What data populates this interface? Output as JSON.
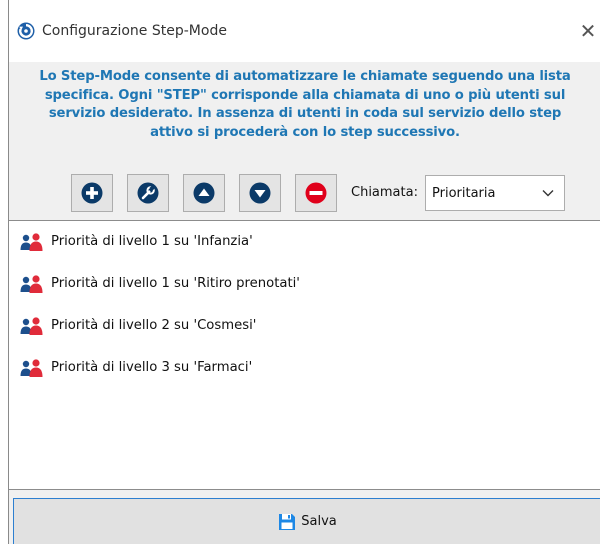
{
  "window": {
    "title": "Configurazione Step-Mode",
    "close_glyph": "✕"
  },
  "description": {
    "lines": [
      "Lo Step-Mode consente di automatizzare le chiamate seguendo una lista",
      "specifica. Ogni \"STEP\" corrisponde alla chiamata di uno o più utenti sul",
      "servizio desiderato. In assenza di utenti in coda sul servizio dello step",
      "attivo si procederà con lo step successivo."
    ],
    "color": "#1f77b4"
  },
  "toolbar": {
    "buttons": [
      {
        "name": "add",
        "icon": "plus-circle-icon",
        "color": "#0b3a68"
      },
      {
        "name": "edit",
        "icon": "wrench-icon",
        "color": "#0b3a68"
      },
      {
        "name": "move-up",
        "icon": "triangle-up-icon",
        "color": "#0b3a68"
      },
      {
        "name": "move-down",
        "icon": "triangle-down-icon",
        "color": "#0b3a68"
      },
      {
        "name": "remove",
        "icon": "minus-circle-icon",
        "color": "#e0001b"
      }
    ],
    "chiamata_label": "Chiamata:",
    "chiamata_value": "Prioritaria"
  },
  "steps": [
    {
      "label": "Priorità di livello 1 su 'Infanzia'",
      "icon": "users-icon"
    },
    {
      "label": "Priorità di livello 1 su 'Ritiro prenotati'",
      "icon": "users-icon"
    },
    {
      "label": "Priorità di livello 2 su 'Cosmesi'",
      "icon": "users-icon"
    },
    {
      "label": "Priorità di livello 3 su 'Farmaci'",
      "icon": "users-icon"
    }
  ],
  "save_button": {
    "label": "Salva",
    "icon": "floppy-disk-icon",
    "color": "#1e88e5"
  }
}
